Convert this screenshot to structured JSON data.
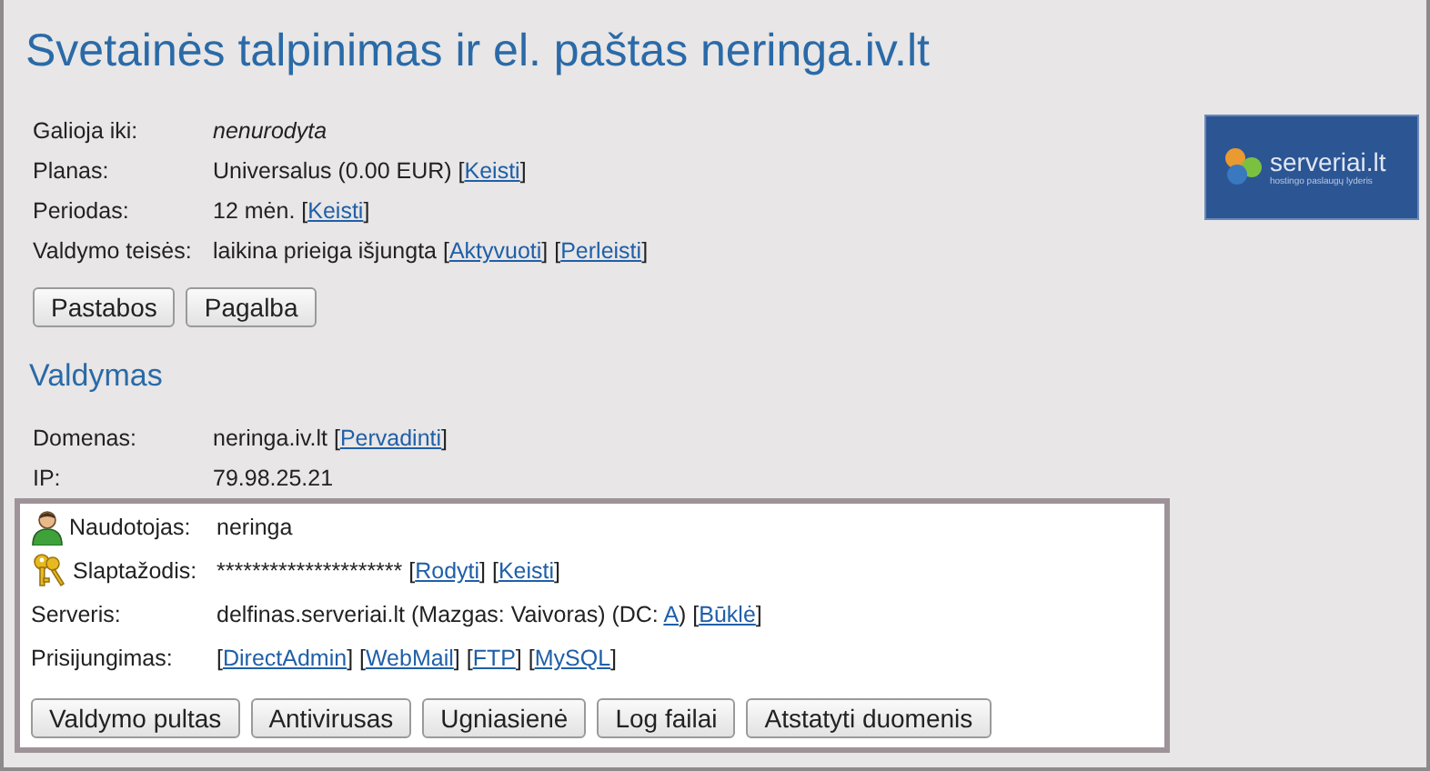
{
  "title": "Svetainės talpinimas ir el. paštas neringa.iv.lt",
  "logo": {
    "name": "serveriai.lt",
    "tagline": "hostingo paslaugų lyderis"
  },
  "info": [
    {
      "label": "Galioja iki:",
      "parts": [
        {
          "kind": "em",
          "text": "nenurodyta"
        }
      ]
    },
    {
      "label": "Planas:",
      "parts": [
        {
          "kind": "text",
          "text": "Universalus (0.00 EUR) ["
        },
        {
          "kind": "link",
          "text": "Keisti"
        },
        {
          "kind": "text",
          "text": "]"
        }
      ]
    },
    {
      "label": "Periodas:",
      "parts": [
        {
          "kind": "text",
          "text": "12 mėn. ["
        },
        {
          "kind": "link",
          "text": "Keisti"
        },
        {
          "kind": "text",
          "text": "]"
        }
      ]
    },
    {
      "label": "Valdymo teisės:",
      "parts": [
        {
          "kind": "text",
          "text": "laikina prieiga išjungta ["
        },
        {
          "kind": "link",
          "text": "Aktyvuoti"
        },
        {
          "kind": "text",
          "text": "] ["
        },
        {
          "kind": "link",
          "text": "Perleisti"
        },
        {
          "kind": "text",
          "text": "]"
        }
      ]
    }
  ],
  "info_buttons": [
    "Pastabos",
    "Pagalba"
  ],
  "section_title": "Valdymas",
  "domain_rows": [
    {
      "label": "Domenas:",
      "parts": [
        {
          "kind": "text",
          "text": "neringa.iv.lt ["
        },
        {
          "kind": "link",
          "text": "Pervadinti"
        },
        {
          "kind": "text",
          "text": "]"
        }
      ]
    },
    {
      "label": "IP:",
      "parts": [
        {
          "kind": "text",
          "text": "79.98.25.21"
        }
      ]
    }
  ],
  "account_rows": [
    {
      "label": "Naudotojas:",
      "kind": "user",
      "parts": [
        {
          "kind": "text",
          "text": "neringa"
        }
      ]
    },
    {
      "label": "Slaptažodis:",
      "kind": "password",
      "parts": [
        {
          "kind": "text",
          "text": "********************* ["
        },
        {
          "kind": "link",
          "text": "Rodyti"
        },
        {
          "kind": "text",
          "text": "] ["
        },
        {
          "kind": "link",
          "text": "Keisti"
        },
        {
          "kind": "text",
          "text": "]"
        }
      ]
    },
    {
      "label": "Serveris:",
      "kind": "plain",
      "parts": [
        {
          "kind": "text",
          "text": "delfinas.serveriai.lt (Mazgas: Vaivoras) (DC: "
        },
        {
          "kind": "link",
          "text": "A"
        },
        {
          "kind": "text",
          "text": ") ["
        },
        {
          "kind": "link",
          "text": "Būklė"
        },
        {
          "kind": "text",
          "text": "]"
        }
      ]
    },
    {
      "label": "Prisijungimas:",
      "kind": "plain",
      "parts": [
        {
          "kind": "text",
          "text": "["
        },
        {
          "kind": "link",
          "text": "DirectAdmin"
        },
        {
          "kind": "text",
          "text": "] ["
        },
        {
          "kind": "link",
          "text": "WebMail"
        },
        {
          "kind": "text",
          "text": "] ["
        },
        {
          "kind": "link",
          "text": "FTP"
        },
        {
          "kind": "text",
          "text": "] ["
        },
        {
          "kind": "link",
          "text": "MySQL"
        },
        {
          "kind": "text",
          "text": "]"
        }
      ]
    }
  ],
  "account_buttons": [
    "Valdymo pultas",
    "Antivirusas",
    "Ugniasienė",
    "Log failai",
    "Atstatyti duomenis"
  ]
}
